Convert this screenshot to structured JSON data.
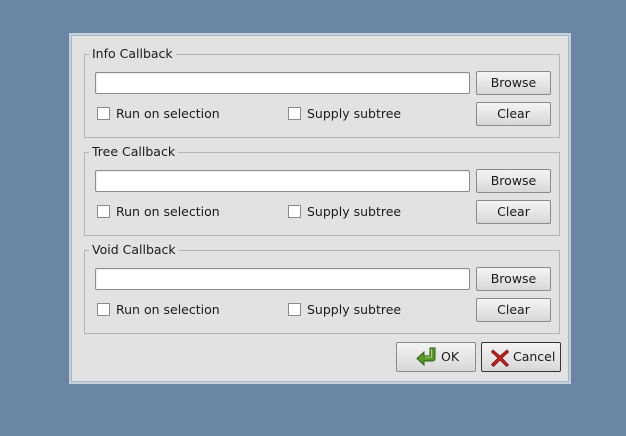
{
  "groups": [
    {
      "title": "Info Callback",
      "input_value": "",
      "browse_label": "Browse",
      "clear_label": "Clear",
      "run_on_selection_label": "Run on selection",
      "run_on_selection_checked": false,
      "supply_subtree_label": "Supply subtree",
      "supply_subtree_checked": false
    },
    {
      "title": "Tree Callback",
      "input_value": "",
      "browse_label": "Browse",
      "clear_label": "Clear",
      "run_on_selection_label": "Run on selection",
      "run_on_selection_checked": false,
      "supply_subtree_label": "Supply subtree",
      "supply_subtree_checked": false
    },
    {
      "title": "Void Callback",
      "input_value": "",
      "browse_label": "Browse",
      "clear_label": "Clear",
      "run_on_selection_label": "Run on selection",
      "run_on_selection_checked": false,
      "supply_subtree_label": "Supply subtree",
      "supply_subtree_checked": false
    }
  ],
  "buttons": {
    "ok_label": "OK",
    "ok_icon": "green-return-arrow-icon",
    "cancel_label": "Cancel",
    "cancel_icon": "red-x-icon"
  },
  "colors": {
    "desktop": "#6a86a4",
    "dialog": "#e2e2e2",
    "ok_icon": "#5a9a2a",
    "cancel_icon": "#c0221e"
  }
}
